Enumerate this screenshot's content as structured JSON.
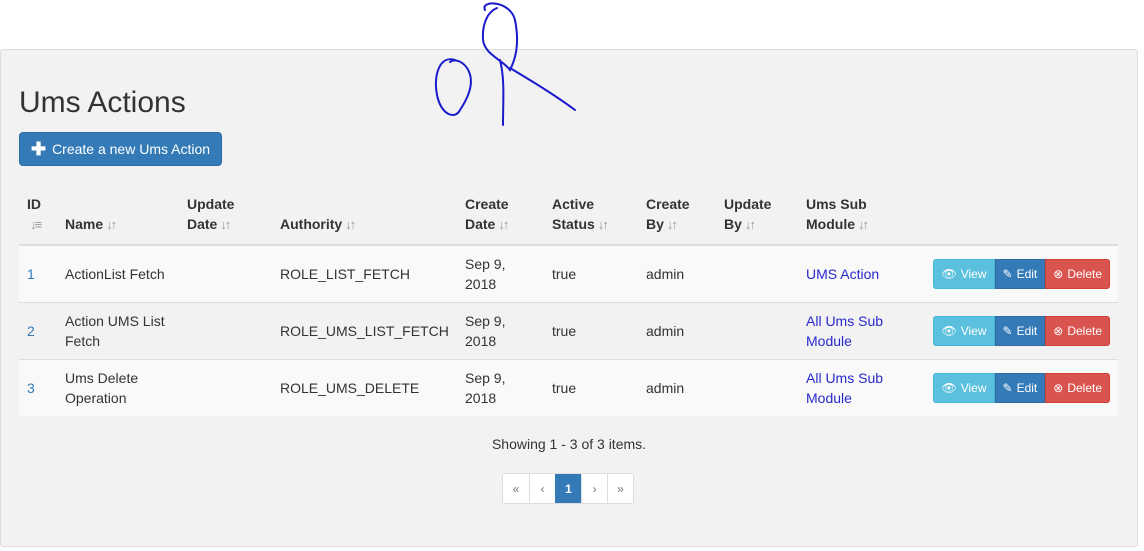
{
  "page": {
    "title": "Ums Actions",
    "create_button": "Create a new Ums Action"
  },
  "table": {
    "columns": [
      {
        "line1": "ID",
        "line2": "",
        "sort": "↓≡"
      },
      {
        "line1": "",
        "line2": "Name",
        "sort": "↓↑"
      },
      {
        "line1": "Update",
        "line2": "Date",
        "sort": "↓↑"
      },
      {
        "line1": "",
        "line2": "Authority",
        "sort": "↓↑"
      },
      {
        "line1": "Create",
        "line2": "Date",
        "sort": "↓↑"
      },
      {
        "line1": "Active",
        "line2": "Status",
        "sort": "↓↑"
      },
      {
        "line1": "Create",
        "line2": "By",
        "sort": "↓↑"
      },
      {
        "line1": "Update",
        "line2": "By",
        "sort": "↓↑"
      },
      {
        "line1": "Ums Sub",
        "line2": "Module",
        "sort": "↓↑"
      }
    ],
    "rows": [
      {
        "id": "1",
        "name": "ActionList Fetch",
        "update_date": "",
        "authority": "ROLE_LIST_FETCH",
        "create_date": "Sep 9, 2018",
        "active_status": "true",
        "create_by": "admin",
        "update_by": "",
        "sub_module": "UMS Action"
      },
      {
        "id": "2",
        "name": "Action UMS List Fetch",
        "update_date": "",
        "authority": "ROLE_UMS_LIST_FETCH",
        "create_date": "Sep 9, 2018",
        "active_status": "true",
        "create_by": "admin",
        "update_by": "",
        "sub_module": "All Ums Sub Module"
      },
      {
        "id": "3",
        "name": "Ums Delete Operation",
        "update_date": "",
        "authority": "ROLE_UMS_DELETE",
        "create_date": "Sep 9, 2018",
        "active_status": "true",
        "create_by": "admin",
        "update_by": "",
        "sub_module": "All Ums Sub Module"
      }
    ],
    "actions": {
      "view": "View",
      "edit": "Edit",
      "delete": "Delete"
    }
  },
  "summary": "Showing 1 - 3 of 3 items.",
  "pagination": {
    "items": [
      "«",
      "‹",
      "1",
      "›",
      "»"
    ],
    "current": "1"
  },
  "icons": {
    "create": "plus-icon",
    "view": "eye-icon",
    "edit": "pencil-icon",
    "delete": "times-circle-icon",
    "sort": "sort-icon"
  },
  "colors": {
    "primary": "#337ab7",
    "info": "#5bc0de",
    "danger": "#d9534f",
    "link": "#2929cc",
    "panel_bg": "#f2f2f2"
  }
}
